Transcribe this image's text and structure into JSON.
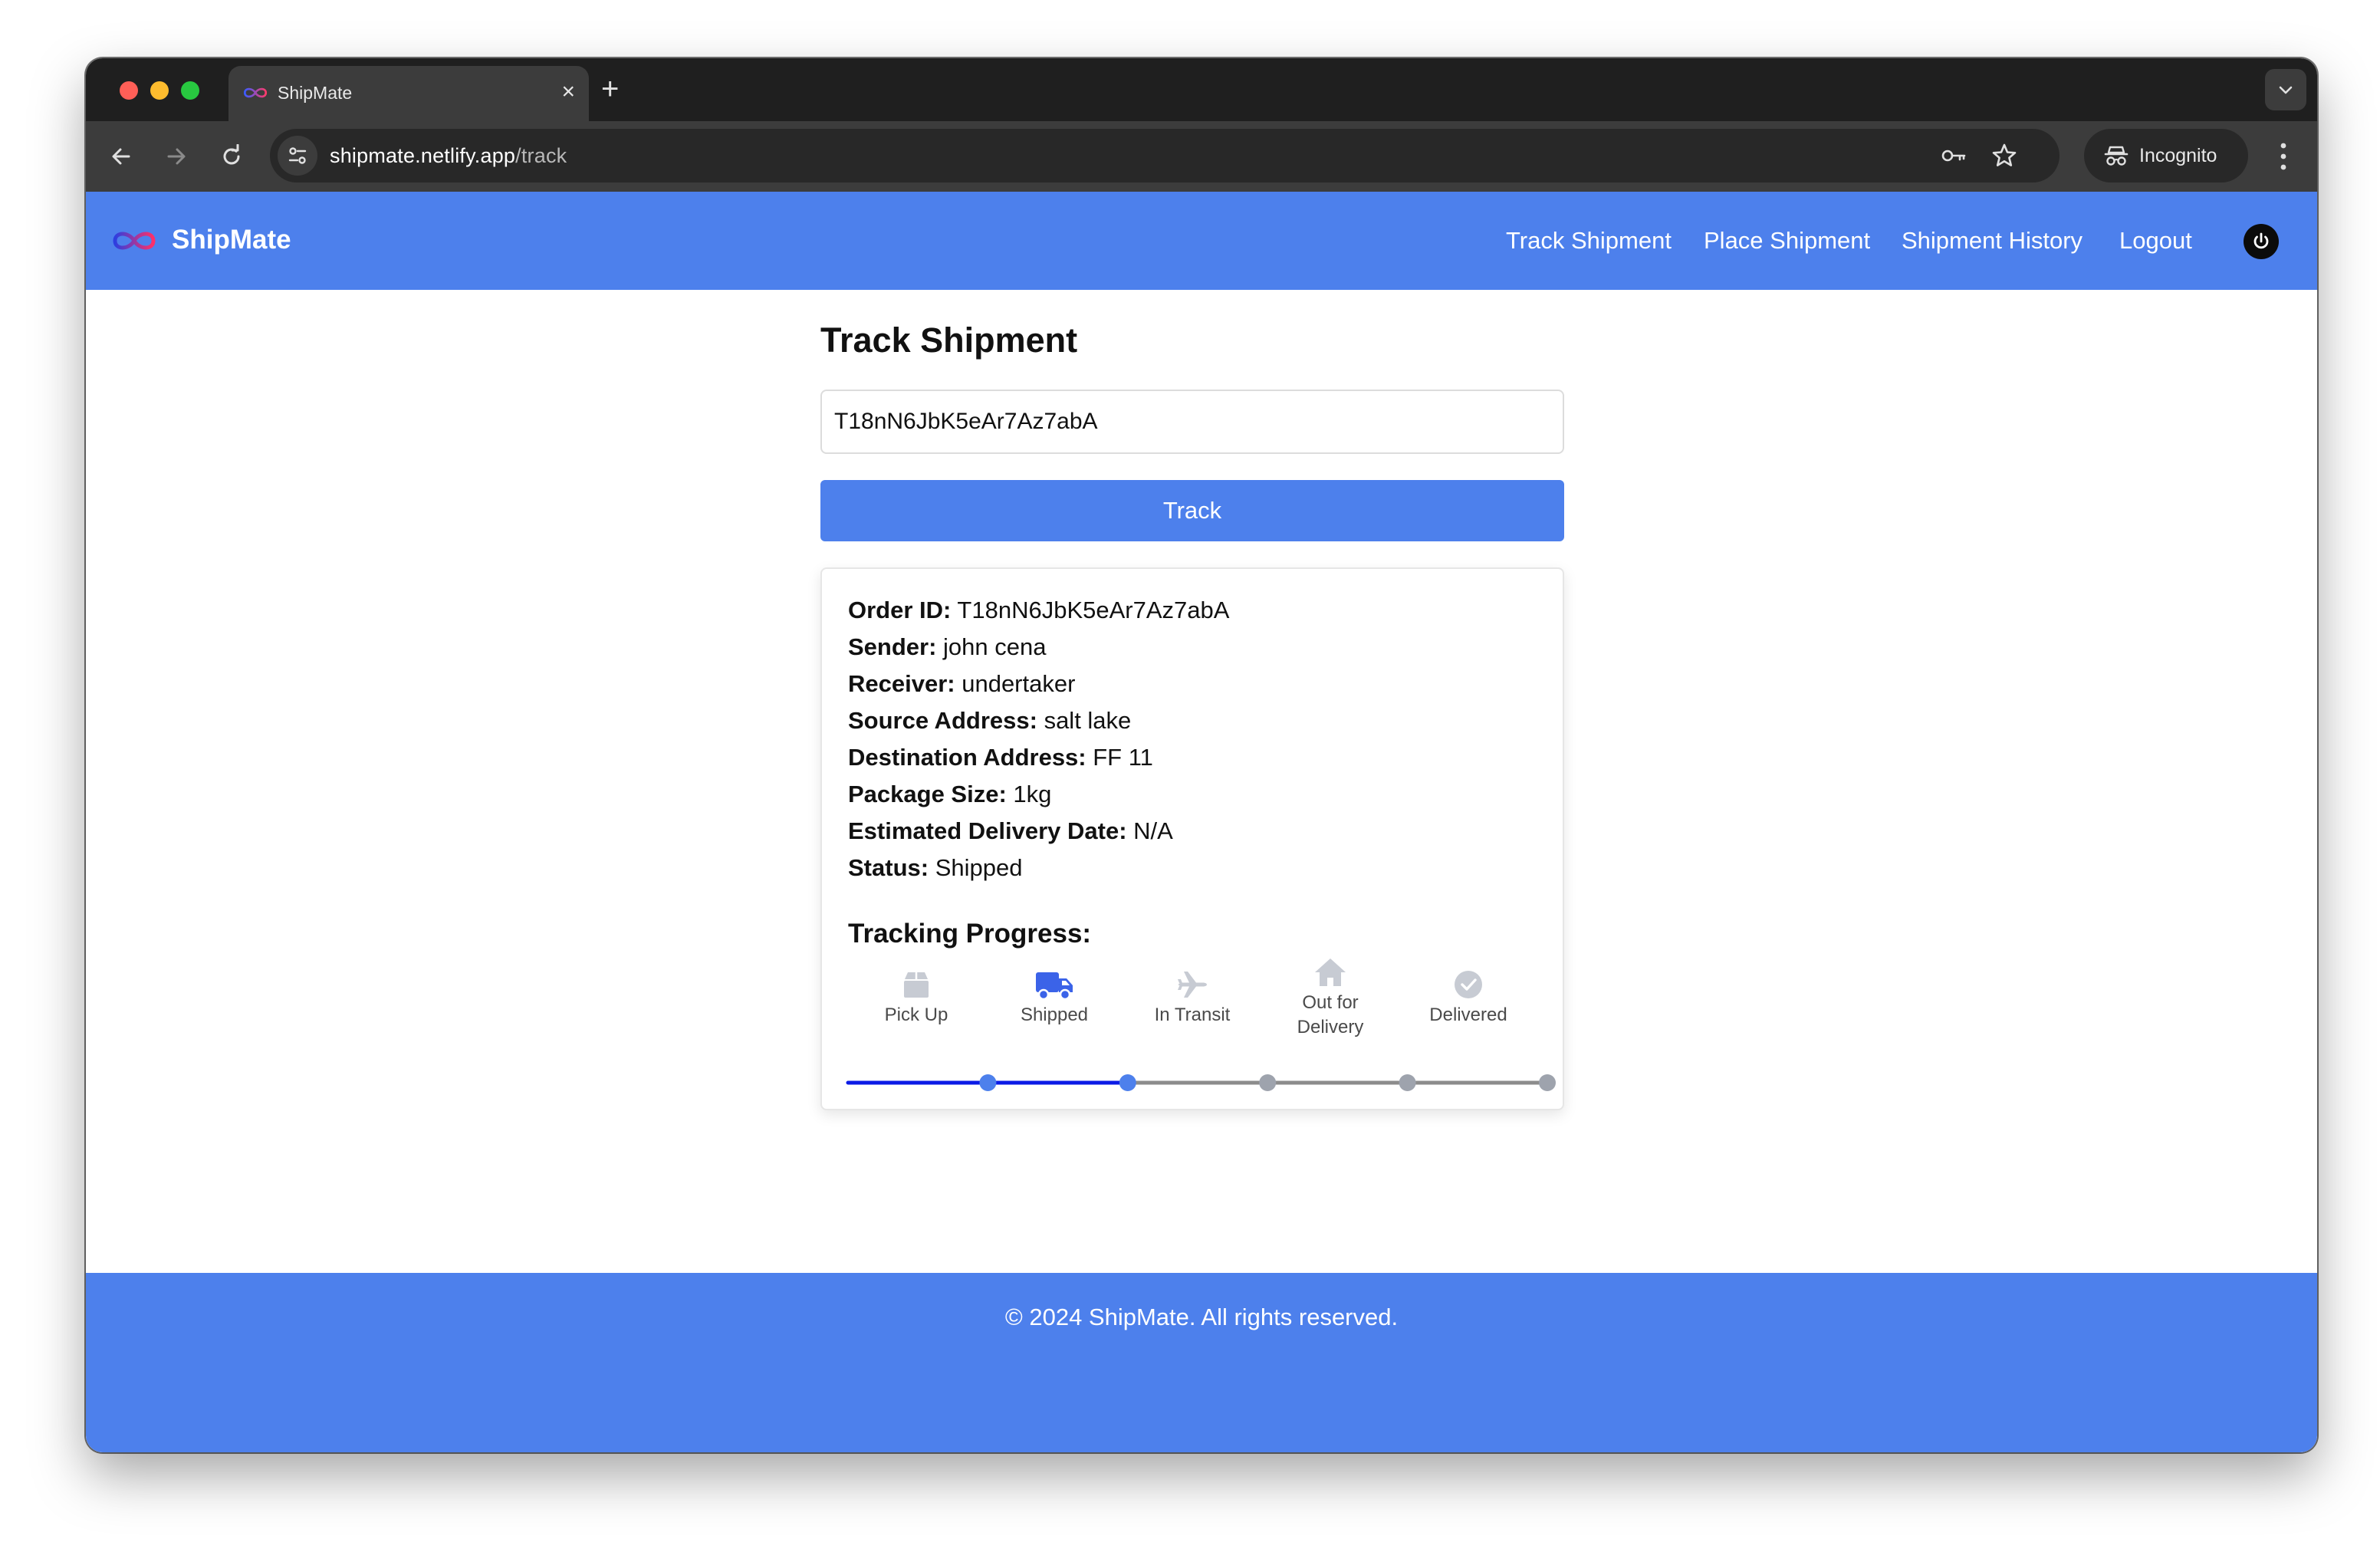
{
  "browser": {
    "tab_title": "ShipMate",
    "tab_close": "×",
    "new_tab": "+",
    "url_host": "shipmate.netlify.app",
    "url_path": "/track",
    "incognito_label": "Incognito",
    "icons": [
      "back-arrow-icon",
      "forward-arrow-icon",
      "reload-icon",
      "site-settings-icon",
      "password-key-icon",
      "bookmark-star-icon",
      "incognito-icon",
      "more-menu-icon",
      "tab-search-chevron-icon"
    ]
  },
  "navbar": {
    "brand": "ShipMate",
    "links": [
      "Track Shipment",
      "Place Shipment",
      "Shipment History",
      "Logout"
    ],
    "accent_color": "#4d80ec",
    "power_icon": "power-icon"
  },
  "page": {
    "title": "Track Shipment",
    "input_value": "T18nN6JbK5eAr7Az7abA",
    "track_button": "Track"
  },
  "details": [
    {
      "label": "Order ID:",
      "value": "T18nN6JbK5eAr7Az7abA"
    },
    {
      "label": "Sender:",
      "value": "john cena"
    },
    {
      "label": "Receiver:",
      "value": "undertaker"
    },
    {
      "label": "Source Address:",
      "value": "salt lake"
    },
    {
      "label": "Destination Address:",
      "value": "FF 11"
    },
    {
      "label": "Package Size:",
      "value": "1kg"
    },
    {
      "label": "Estimated Delivery Date:",
      "value": "N/A"
    },
    {
      "label": "Status:",
      "value": "Shipped"
    }
  ],
  "tracking": {
    "title": "Tracking Progress:",
    "steps": [
      {
        "label": "Pick Up",
        "icon": "box-icon",
        "active": false
      },
      {
        "label": "Shipped",
        "icon": "truck-icon",
        "active": true
      },
      {
        "label": "In Transit",
        "icon": "airplane-icon",
        "active": false
      },
      {
        "label": "Out for Delivery",
        "icon": "house-icon",
        "active": false
      },
      {
        "label": "Delivered",
        "icon": "check-circle-icon",
        "active": false
      }
    ],
    "completed_steps": 2,
    "total_steps": 5,
    "progress_color": "#0b1be6",
    "track_color": "#8c8c8c",
    "active_dot_color": "#4d80ec",
    "inactive_dot_color": "#9ea3ad"
  },
  "footer": {
    "text": "© 2024 ShipMate. All rights reserved."
  }
}
